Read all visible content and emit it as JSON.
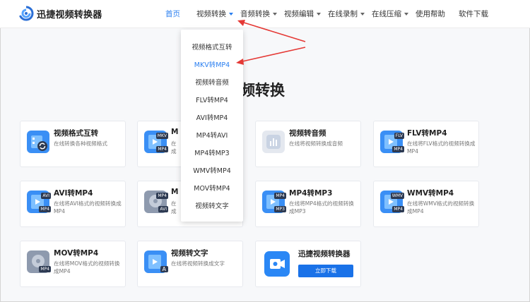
{
  "header": {
    "brand": "迅捷视频转换器",
    "nav": [
      {
        "label": "首页",
        "active": true,
        "caret": false
      },
      {
        "label": "视频转换",
        "active": false,
        "caret": true
      },
      {
        "label": "音频转换",
        "active": false,
        "caret": true
      },
      {
        "label": "视频编辑",
        "active": false,
        "caret": true
      },
      {
        "label": "在线录制",
        "active": false,
        "caret": true
      },
      {
        "label": "在线压缩",
        "active": false,
        "caret": true
      },
      {
        "label": "使用帮助",
        "active": false,
        "caret": false
      },
      {
        "label": "软件下载",
        "active": false,
        "caret": false
      }
    ]
  },
  "section_title": "频转换",
  "dropdown": {
    "items": [
      "视频格式互转",
      "MKV转MP4",
      "视频转音频",
      "FLV转MP4",
      "AVI转MP4",
      "MP4转AVI",
      "MP4转MP3",
      "WMV转MP4",
      "MOV转MP4",
      "视频转文字"
    ],
    "selected_index": 1
  },
  "cards": [
    {
      "title": "视频格式互转",
      "desc": "在线转换各种视频格式",
      "icon": "video-convert-icon",
      "badge": ""
    },
    {
      "title": "M",
      "desc": "在\n成",
      "icon": "mkv-file-icon",
      "badge": "MKV"
    },
    {
      "title": "视频转音频",
      "desc": "在线将视频转换成音频",
      "icon": "audio-chart-icon",
      "badge": ""
    },
    {
      "title": "FLV转MP4",
      "desc": "在线将FLV格式的视频转换成MP4",
      "icon": "flv-file-icon",
      "badge": "FLV"
    },
    {
      "title": "AVI转MP4",
      "desc": "在线将AVI格式的视频转换成MP4",
      "icon": "avi-file-icon",
      "badge": "AVI"
    },
    {
      "title": "M",
      "desc": "在\n成",
      "icon": "mp4-avi-icon",
      "badge": "AVI"
    },
    {
      "title": "MP4转MP3",
      "desc": "在线将MP4格式的视频转换成MP3",
      "icon": "mp3-file-icon",
      "badge": "MP3"
    },
    {
      "title": "WMV转MP4",
      "desc": "在线将WMV格式的视频转换成MP4",
      "icon": "wmv-file-icon",
      "badge": "WMV"
    },
    {
      "title": "MOV转MP4",
      "desc": "在线将MOV格式的视频转换成MP4",
      "icon": "mov-file-icon",
      "badge": "MP4"
    },
    {
      "title": "视频转文字",
      "desc": "在线将视频转换成文字",
      "icon": "video-text-icon",
      "badge": "A"
    }
  ],
  "promo": {
    "title": "迅捷视频转换器",
    "button": "立即下载"
  },
  "colors": {
    "accent": "#2a7ff0",
    "arrow": "#e53935",
    "icon_blue": "#3a8ff5",
    "icon_gray": "#8e9aae"
  }
}
